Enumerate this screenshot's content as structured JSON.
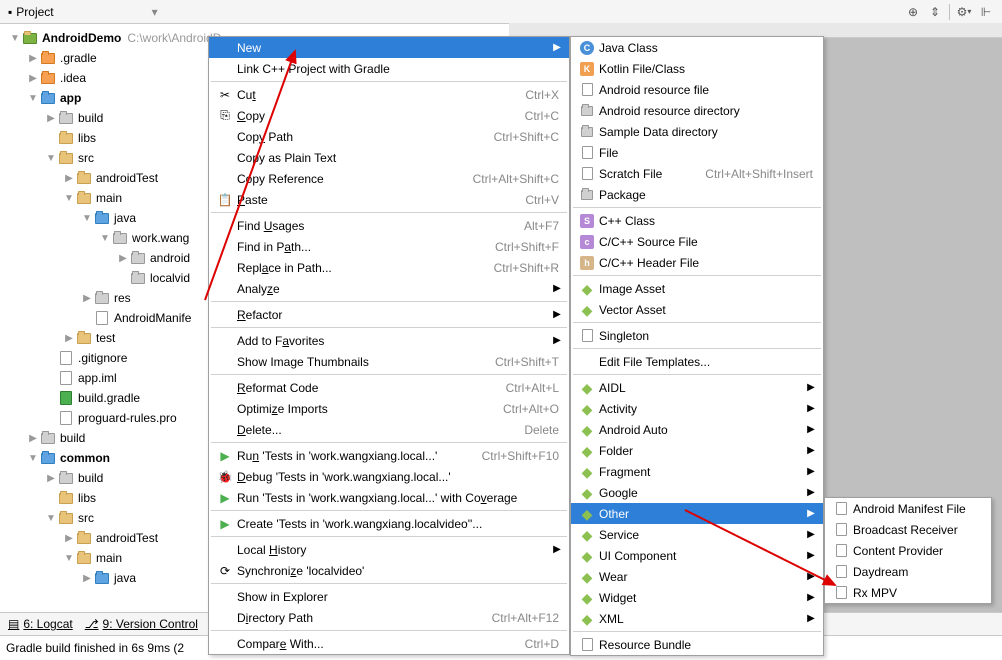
{
  "toolbar": {
    "title": "Project"
  },
  "tree": [
    {
      "indent": 0,
      "arrow": "▼",
      "fold": "app",
      "bold": true,
      "label": "AndroidDemo",
      "path": "C:\\work\\AndroidD..."
    },
    {
      "indent": 1,
      "arrow": "▶",
      "fold": "orange",
      "label": ".gradle"
    },
    {
      "indent": 1,
      "arrow": "▶",
      "fold": "orange",
      "label": ".idea"
    },
    {
      "indent": 1,
      "arrow": "▼",
      "fold": "blue",
      "bold": true,
      "label": "app"
    },
    {
      "indent": 2,
      "arrow": "▶",
      "fold": "gray",
      "label": "build"
    },
    {
      "indent": 2,
      "arrow": "",
      "fold": "yellow",
      "label": "libs"
    },
    {
      "indent": 2,
      "arrow": "▼",
      "fold": "yellow",
      "label": "src"
    },
    {
      "indent": 3,
      "arrow": "▶",
      "fold": "yellow",
      "label": "androidTest"
    },
    {
      "indent": 3,
      "arrow": "▼",
      "fold": "yellow",
      "label": "main"
    },
    {
      "indent": 4,
      "arrow": "▼",
      "fold": "blue",
      "label": "java"
    },
    {
      "indent": 5,
      "arrow": "▼",
      "fold": "gray",
      "label": "work.wang"
    },
    {
      "indent": 6,
      "arrow": "▶",
      "fold": "gray",
      "label": "android"
    },
    {
      "indent": 6,
      "arrow": "",
      "fold": "gray",
      "label": "localvid"
    },
    {
      "indent": 4,
      "arrow": "▶",
      "fold": "gray",
      "label": "res"
    },
    {
      "indent": 4,
      "arrow": "",
      "fold": "file",
      "label": "AndroidManife"
    },
    {
      "indent": 3,
      "arrow": "▶",
      "fold": "yellow",
      "label": "test"
    },
    {
      "indent": 2,
      "arrow": "",
      "fold": "file",
      "label": ".gitignore"
    },
    {
      "indent": 2,
      "arrow": "",
      "fold": "file",
      "label": "app.iml"
    },
    {
      "indent": 2,
      "arrow": "",
      "fold": "gradle",
      "label": "build.gradle"
    },
    {
      "indent": 2,
      "arrow": "",
      "fold": "file",
      "label": "proguard-rules.pro"
    },
    {
      "indent": 1,
      "arrow": "▶",
      "fold": "gray",
      "label": "build"
    },
    {
      "indent": 1,
      "arrow": "▼",
      "fold": "blue",
      "bold": true,
      "label": "common"
    },
    {
      "indent": 2,
      "arrow": "▶",
      "fold": "gray",
      "label": "build"
    },
    {
      "indent": 2,
      "arrow": "",
      "fold": "yellow",
      "label": "libs"
    },
    {
      "indent": 2,
      "arrow": "▼",
      "fold": "yellow",
      "label": "src"
    },
    {
      "indent": 3,
      "arrow": "▶",
      "fold": "yellow",
      "label": "androidTest"
    },
    {
      "indent": 3,
      "arrow": "▼",
      "fold": "yellow",
      "label": "main"
    },
    {
      "indent": 4,
      "arrow": "▶",
      "fold": "blue",
      "label": "java"
    }
  ],
  "menu1": [
    {
      "label": "New",
      "sel": true,
      "arrow": true
    },
    {
      "label": "Link C++ Project with Gradle"
    },
    {
      "sep": true
    },
    {
      "icon": "cut",
      "label": "Cu<u>t</u>",
      "short": "Ctrl+X"
    },
    {
      "icon": "copy",
      "label": "<u>C</u>opy",
      "short": "Ctrl+C"
    },
    {
      "label": "Cop<u>y</u> Path",
      "short": "Ctrl+Shift+C"
    },
    {
      "label": "Copy as Plain Text"
    },
    {
      "label": "Copy Reference",
      "short": "Ctrl+Alt+Shift+C"
    },
    {
      "icon": "paste",
      "label": "<u>P</u>aste",
      "short": "Ctrl+V"
    },
    {
      "sep": true
    },
    {
      "label": "Find <u>U</u>sages",
      "short": "Alt+F7"
    },
    {
      "label": "Find in P<u>a</u>th...",
      "short": "Ctrl+Shift+F"
    },
    {
      "label": "Repl<u>a</u>ce in Path...",
      "short": "Ctrl+Shift+R"
    },
    {
      "label": "Analy<u>z</u>e",
      "arrow": true
    },
    {
      "sep": true
    },
    {
      "label": "<u>R</u>efactor",
      "arrow": true
    },
    {
      "sep": true
    },
    {
      "label": "Add to F<u>a</u>vorites",
      "arrow": true
    },
    {
      "label": "Show Image Thumbnails",
      "short": "Ctrl+Shift+T"
    },
    {
      "sep": true
    },
    {
      "label": "<u>R</u>eformat Code",
      "short": "Ctrl+Alt+L"
    },
    {
      "label": "Optimi<u>z</u>e Imports",
      "short": "Ctrl+Alt+O"
    },
    {
      "label": "<u>D</u>elete...",
      "short": "Delete"
    },
    {
      "sep": true
    },
    {
      "icon": "run",
      "label": "Ru<u>n</u> 'Tests in 'work.wangxiang.local...'",
      "short": "Ctrl+Shift+F10"
    },
    {
      "icon": "debug",
      "label": "<u>D</u>ebug 'Tests in 'work.wangxiang.local...'"
    },
    {
      "icon": "cover",
      "label": "Run 'Tests in 'work.wangxiang.local...' with Co<u>v</u>erage"
    },
    {
      "sep": true
    },
    {
      "icon": "create",
      "label": "Create 'Tests in 'work.wangxiang.localvideo''..."
    },
    {
      "sep": true
    },
    {
      "label": "Local <u>H</u>istory",
      "arrow": true
    },
    {
      "icon": "sync",
      "label": "Synchroni<u>z</u>e 'localvideo'"
    },
    {
      "sep": true
    },
    {
      "label": "Show in Explorer"
    },
    {
      "label": "D<u>i</u>rectory Path",
      "short": "Ctrl+Alt+F12"
    },
    {
      "sep": true
    },
    {
      "label": "Compar<u>e</u> With...",
      "short": "Ctrl+D"
    }
  ],
  "menu2": [
    {
      "icon": "C",
      "label": "Java Class"
    },
    {
      "icon": "K",
      "label": "Kotlin File/Class"
    },
    {
      "icon": "file",
      "label": "Android resource file"
    },
    {
      "icon": "folder",
      "label": "Android resource directory"
    },
    {
      "icon": "folder",
      "label": "Sample Data directory"
    },
    {
      "icon": "file",
      "label": "File"
    },
    {
      "icon": "file",
      "label": "Scratch File",
      "short": "Ctrl+Alt+Shift+Insert"
    },
    {
      "icon": "folder",
      "label": "Package"
    },
    {
      "sep": true
    },
    {
      "icon": "S",
      "label": "C++ Class"
    },
    {
      "icon": "c",
      "label": "C/C++ Source File"
    },
    {
      "icon": "h",
      "label": "C/C++ Header File"
    },
    {
      "sep": true
    },
    {
      "icon": "android",
      "label": "Image Asset"
    },
    {
      "icon": "android",
      "label": "Vector Asset"
    },
    {
      "sep": true
    },
    {
      "icon": "file",
      "label": "Singleton"
    },
    {
      "sep": true
    },
    {
      "label": "Edit File Templates..."
    },
    {
      "sep": true
    },
    {
      "icon": "android",
      "label": "AIDL",
      "arrow": true
    },
    {
      "icon": "android",
      "label": "Activity",
      "arrow": true
    },
    {
      "icon": "android",
      "label": "Android Auto",
      "arrow": true
    },
    {
      "icon": "android",
      "label": "Folder",
      "arrow": true
    },
    {
      "icon": "android",
      "label": "Fragment",
      "arrow": true
    },
    {
      "icon": "android",
      "label": "Google",
      "arrow": true
    },
    {
      "icon": "android",
      "label": "Other",
      "arrow": true,
      "sel": true
    },
    {
      "icon": "android",
      "label": "Service",
      "arrow": true
    },
    {
      "icon": "android",
      "label": "UI Component",
      "arrow": true
    },
    {
      "icon": "android",
      "label": "Wear",
      "arrow": true
    },
    {
      "icon": "android",
      "label": "Widget",
      "arrow": true
    },
    {
      "icon": "android",
      "label": "XML",
      "arrow": true
    },
    {
      "sep": true
    },
    {
      "icon": "file",
      "label": "Resource Bundle"
    }
  ],
  "menu3": [
    {
      "icon": "file",
      "label": "Android Manifest File"
    },
    {
      "icon": "file",
      "label": "Broadcast Receiver"
    },
    {
      "icon": "file",
      "label": "Content Provider"
    },
    {
      "icon": "file",
      "label": "Daydream"
    },
    {
      "icon": "file",
      "label": "Rx MPV"
    }
  ],
  "status": {
    "tabs": [
      "6: Logcat",
      "9: Version Control"
    ],
    "msg": "Gradle build finished in 6s 9ms (2"
  }
}
